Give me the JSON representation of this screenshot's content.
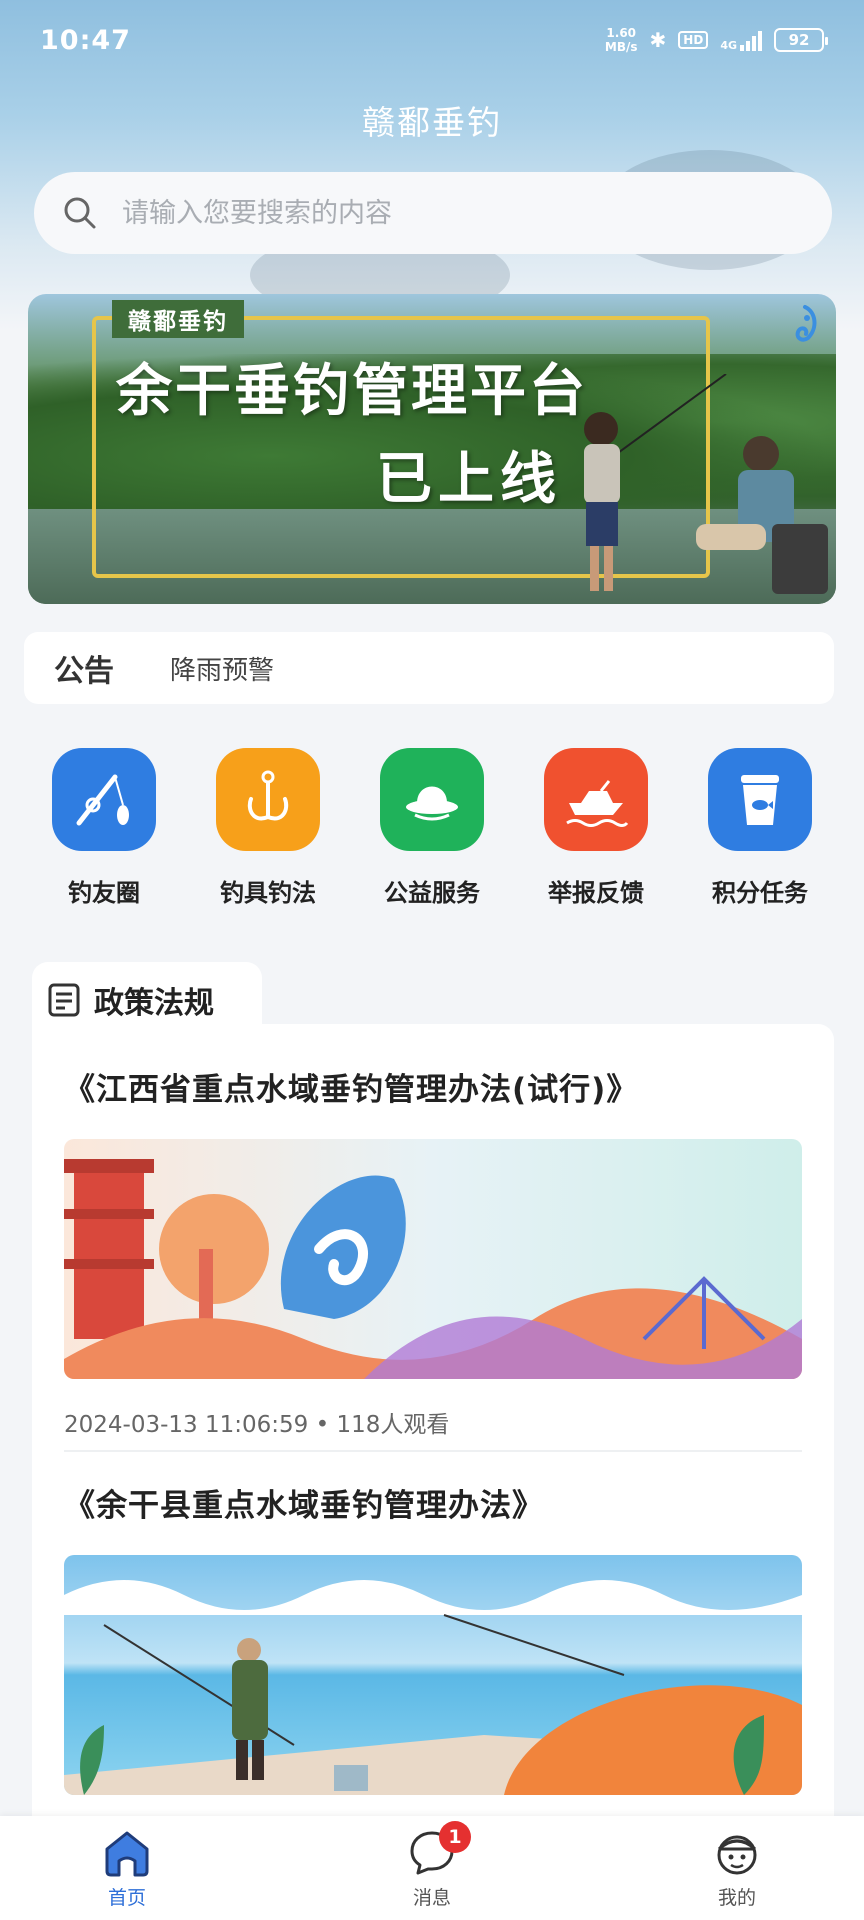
{
  "status_bar": {
    "time": "10:47",
    "speed_value": "1.60",
    "speed_unit": "MB/s",
    "hd": "HD",
    "network": "4G",
    "battery": "92"
  },
  "app": {
    "title": "赣鄱垂钓"
  },
  "search": {
    "placeholder": "请输入您要搜索的内容"
  },
  "banner": {
    "tag": "赣鄱垂钓",
    "headline_line1": "余干垂钓管理平台",
    "headline_line2": "已上线"
  },
  "notice": {
    "label": "公告",
    "text": "降雨预警"
  },
  "quick_menu": [
    {
      "label": "钓友圈",
      "icon": "fishing-rod-icon",
      "color": "#2f7de1"
    },
    {
      "label": "钓具钓法",
      "icon": "fishing-hook-icon",
      "color": "#f7a01a"
    },
    {
      "label": "公益服务",
      "icon": "hat-icon",
      "color": "#1fb25a"
    },
    {
      "label": "举报反馈",
      "icon": "boat-icon",
      "color": "#f0512f"
    },
    {
      "label": "积分任务",
      "icon": "bucket-icon",
      "color": "#2f7de1"
    }
  ],
  "policy": {
    "section_title": "政策法规",
    "articles": [
      {
        "title": "《江西省重点水域垂钓管理办法(试行)》",
        "date": "2024-03-13 11:06:59",
        "views": "118人观看"
      },
      {
        "title": "《余干县重点水域垂钓管理办法》"
      }
    ]
  },
  "bottom_nav": {
    "home": "首页",
    "messages": "消息",
    "messages_badge": "1",
    "mine": "我的"
  }
}
